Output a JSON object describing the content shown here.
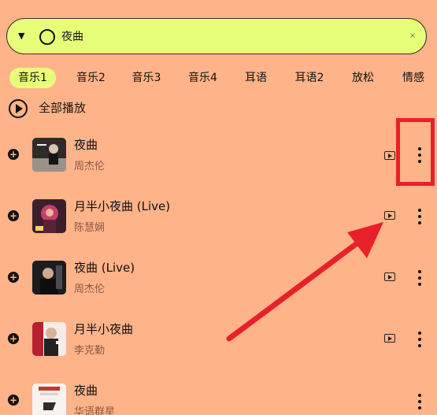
{
  "search": {
    "query": "夜曲",
    "dropdown_glyph": "▼",
    "clear_glyph": "×"
  },
  "tabs": [
    {
      "label": "音乐1",
      "active": true
    },
    {
      "label": "音乐2",
      "active": false
    },
    {
      "label": "音乐3",
      "active": false
    },
    {
      "label": "音乐4",
      "active": false
    },
    {
      "label": "耳语",
      "active": false
    },
    {
      "label": "耳语2",
      "active": false
    },
    {
      "label": "放松",
      "active": false
    },
    {
      "label": "情感",
      "active": false
    }
  ],
  "play_all": {
    "label": "全部播放"
  },
  "songs": [
    {
      "title": "夜曲",
      "artist": "周杰伦",
      "has_mv": true
    },
    {
      "title": "月半小夜曲 (Live)",
      "artist": "陈慧娴",
      "has_mv": true
    },
    {
      "title": "夜曲 (Live)",
      "artist": "周杰伦",
      "has_mv": true
    },
    {
      "title": "月半小夜曲",
      "artist": "李克勤",
      "has_mv": true
    },
    {
      "title": "夜曲",
      "artist": "华语群星",
      "has_mv": false
    }
  ],
  "colors": {
    "background": "#ffb389",
    "accent": "#e7ff78",
    "annotation_red": "#e8202a"
  }
}
